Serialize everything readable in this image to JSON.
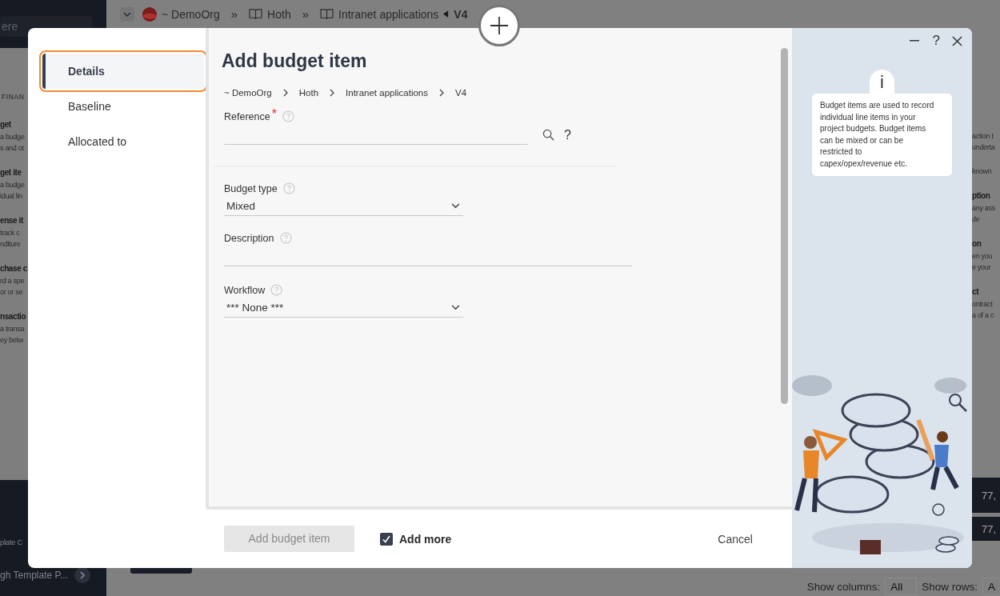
{
  "background": {
    "search": {
      "placeholder": "ere"
    },
    "breadcrumb": [
      {
        "label": "~ DemoOrg",
        "kind": "org"
      },
      {
        "label": "Hoth",
        "kind": "book"
      },
      {
        "label": "Intranet applications",
        "kind": "book"
      },
      {
        "label": "V4",
        "kind": "version"
      }
    ],
    "breadcrumb_separator": "»",
    "section_heading": "FINAN",
    "left_items": [
      {
        "title": "get",
        "lines": [
          "a budge",
          "s and ot"
        ]
      },
      {
        "title": "get ite",
        "lines": [
          "a budge",
          "idual lin"
        ]
      },
      {
        "title": "ense it",
        "lines": [
          "track c",
          "nditure"
        ]
      },
      {
        "title": "chase c",
        "lines": [
          "rd a spe",
          "or or se"
        ]
      },
      {
        "title": "nsactio",
        "lines": [
          "a transa",
          "ey betw"
        ]
      }
    ],
    "right_items": [
      {
        "lines": [
          "action t",
          "underta"
        ]
      },
      {
        "lines": [
          "known"
        ]
      },
      {
        "title": "ption",
        "lines": [
          "any ass",
          "de"
        ]
      },
      {
        "title": "on",
        "lines": [
          "en you",
          "e your"
        ]
      },
      {
        "title": "ct",
        "lines": [
          "ontract",
          "a of a c"
        ]
      }
    ],
    "sidebar_bottom": [
      "plate C",
      "gh Template P..."
    ],
    "row_values": [
      "77,",
      "77,"
    ],
    "show_columns": {
      "label": "Show columns:",
      "value": "All"
    },
    "show_rows": {
      "label": "Show rows:",
      "value": "A"
    }
  },
  "modal": {
    "title": "Add budget item",
    "nav": [
      {
        "label": "Details",
        "selected": true
      },
      {
        "label": "Baseline",
        "selected": false
      },
      {
        "label": "Allocated to",
        "selected": false
      }
    ],
    "breadcrumb": [
      "~ DemoOrg",
      "Hoth",
      "Intranet applications",
      "V4"
    ],
    "fields": [
      {
        "kind": "lookup",
        "label": "Reference",
        "required_mark": "*",
        "hint": "?"
      },
      {
        "kind": "select",
        "label": "Budget type",
        "value": "Mixed"
      },
      {
        "kind": "text",
        "label": "Description"
      },
      {
        "kind": "select",
        "label": "Workflow",
        "value": "*** None ***"
      }
    ],
    "submit": {
      "label": "Add budget item",
      "disabled": true
    },
    "add_more": {
      "label": "Add more",
      "checked": true
    },
    "cancel": "Cancel",
    "help": "?",
    "info": {
      "icon": "i",
      "text": "Budget items are used to record individual line items in your project budgets. Budget items can be mixed or can be restricted to capex/opex/revenue etc."
    }
  }
}
